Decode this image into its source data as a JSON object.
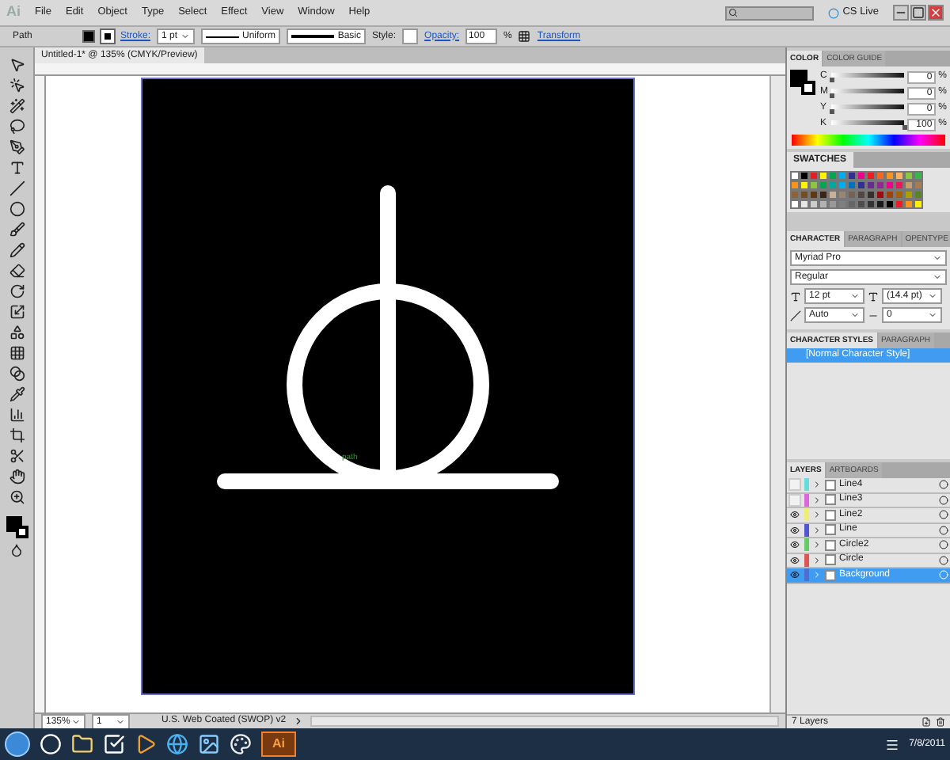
{
  "menu": {
    "logo": "Ai",
    "items": [
      "File",
      "Edit",
      "Object",
      "Type",
      "Select",
      "Effect",
      "View",
      "Window",
      "Help"
    ],
    "cs_live": "CS Live"
  },
  "control_bar": {
    "selection": "Path",
    "stroke_label": "Stroke:",
    "stroke_weight": "1 pt",
    "profile": "Uniform",
    "brush": "Basic",
    "style_label": "Style:",
    "opacity_label": "Opacity:",
    "opacity": "100",
    "percent": "%",
    "transform": "Transform"
  },
  "document": {
    "tab": "Untitled-1* @ 135% (CMYK/Preview)",
    "smart_guide": "path"
  },
  "color_panel": {
    "tabs": [
      {
        "label": "COLOR",
        "selected": true
      },
      {
        "label": "COLOR GUIDE",
        "selected": false
      }
    ],
    "channels": [
      {
        "name": "C",
        "level": 0,
        "value": "0"
      },
      {
        "name": "M",
        "level": 0,
        "value": "0"
      },
      {
        "name": "Y",
        "level": 0,
        "value": "0"
      },
      {
        "name": "K",
        "level": 1,
        "value": "100"
      }
    ],
    "unit": "%"
  },
  "swatches_panel": {
    "tab": "SWATCHES",
    "swatches": [
      {
        "color": "#ffffff"
      },
      {
        "color": "#000000"
      },
      {
        "color": "#e31e24"
      },
      {
        "color": "#fff200"
      },
      {
        "color": "#00a651"
      },
      {
        "color": "#00aeef"
      },
      {
        "color": "#2e3192"
      },
      {
        "color": "#ec008c"
      },
      {
        "color": "#ed1c24"
      },
      {
        "color": "#f26522"
      },
      {
        "color": "#f7941d"
      },
      {
        "color": "#fbaf5d"
      },
      {
        "color": "#8dc63f"
      },
      {
        "color": "#39b54a"
      },
      {
        "color": "#f7941d"
      },
      {
        "color": "#fff200"
      },
      {
        "color": "#8dc63f"
      },
      {
        "color": "#00a651"
      },
      {
        "color": "#00a99d"
      },
      {
        "color": "#00aeef"
      },
      {
        "color": "#0072bc"
      },
      {
        "color": "#2e3192"
      },
      {
        "color": "#662d91"
      },
      {
        "color": "#92278f"
      },
      {
        "color": "#ec008c"
      },
      {
        "color": "#ed145b"
      },
      {
        "color": "#c69c6d"
      },
      {
        "color": "#a67c52"
      },
      {
        "color": "#8c6239"
      },
      {
        "color": "#754c24"
      },
      {
        "color": "#603913"
      },
      {
        "color": "#3c2415"
      },
      {
        "color": "#c7b299"
      },
      {
        "color": "#998675"
      },
      {
        "color": "#736357"
      },
      {
        "color": "#534741"
      },
      {
        "color": "#362f2d"
      },
      {
        "color": "#9e0b0f"
      },
      {
        "color": "#a0410d"
      },
      {
        "color": "#a36209"
      },
      {
        "color": "#aba000"
      },
      {
        "color": "#598527"
      },
      {
        "color": "#ffffff"
      },
      {
        "color": "#e6e6e6"
      },
      {
        "color": "#cccccc"
      },
      {
        "color": "#b3b3b3"
      },
      {
        "color": "#999999"
      },
      {
        "color": "#808080"
      },
      {
        "color": "#666666"
      },
      {
        "color": "#4d4d4d"
      },
      {
        "color": "#333333"
      },
      {
        "color": "#1a1a1a"
      },
      {
        "color": "#000000"
      },
      {
        "color": "#ed1c24"
      },
      {
        "color": "#f7941d"
      },
      {
        "color": "#fff200"
      }
    ]
  },
  "character_panel": {
    "tabs": [
      {
        "label": "CHARACTER",
        "selected": true
      },
      {
        "label": "PARAGRAPH",
        "selected": false
      },
      {
        "label": "OPENTYPE",
        "selected": false
      }
    ],
    "font": "Myriad Pro",
    "style": "Regular",
    "size": "12 pt",
    "leading": "(14.4 pt)",
    "kerning": "Auto",
    "tracking": "0"
  },
  "character_styles_panel": {
    "tabs": [
      {
        "label": "CHARACTER STYLES",
        "selected": true
      },
      {
        "label": "PARAGRAPH",
        "selected": false
      }
    ],
    "items": [
      {
        "label": "[Normal Character Style]",
        "selected": true
      }
    ]
  },
  "layers_panel": {
    "tabs": [
      {
        "label": "LAYERS",
        "selected": true
      },
      {
        "label": "ARTBOARDS",
        "selected": false
      }
    ],
    "layers": [
      {
        "name": "Line4",
        "visible": false,
        "color": "#66dddd",
        "selected": false
      },
      {
        "name": "Line3",
        "visible": false,
        "color": "#dd66dd",
        "selected": false
      },
      {
        "name": "Line2",
        "visible": true,
        "color": "#eeee77",
        "selected": false
      },
      {
        "name": "Line",
        "visible": true,
        "color": "#5555cc",
        "selected": false
      },
      {
        "name": "Circle2",
        "visible": true,
        "color": "#66cc66",
        "selected": false
      },
      {
        "name": "Circle",
        "visible": true,
        "color": "#dd5555",
        "selected": false
      },
      {
        "name": "Background",
        "visible": true,
        "color": "#4f6fd0",
        "selected": true
      }
    ],
    "count": "7 Layers"
  },
  "status_bar": {
    "zoom": "135%",
    "artboard": "1",
    "profile": "U.S. Web Coated (SWOP) v2"
  },
  "taskbar": {
    "clock": "7/8/2011",
    "app_label": "Ai"
  }
}
